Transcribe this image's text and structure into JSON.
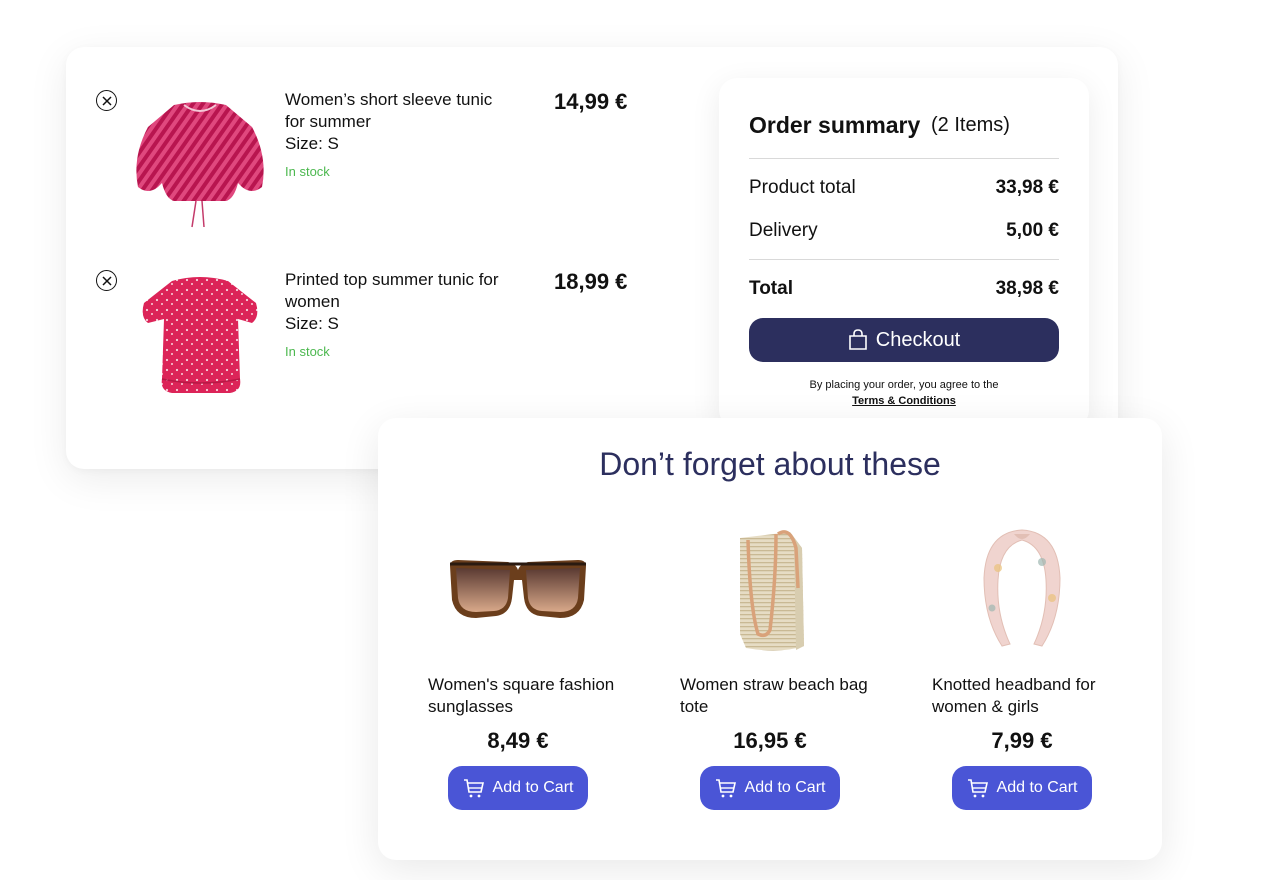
{
  "cart": {
    "items": [
      {
        "name": "Women’s short sleeve tunic for summer",
        "size": "Size: S",
        "stock": "In stock",
        "price": "14,99 €",
        "image": "pink-striped-blouse"
      },
      {
        "name": "Printed top summer tunic for women",
        "size": "Size: S",
        "stock": "In stock",
        "price": "18,99 €",
        "image": "pink-printed-top"
      }
    ]
  },
  "summary": {
    "title": "Order summary",
    "count": "(2 Items)",
    "product_total_label": "Product total",
    "product_total_value": "33,98 €",
    "delivery_label": "Delivery",
    "delivery_value": "5,00 €",
    "total_label": "Total",
    "total_value": "38,98 €",
    "checkout_label": "Checkout",
    "terms_text": "By placing your order, you agree to the",
    "terms_link": "Terms & Conditions"
  },
  "recommendations": {
    "title": "Don’t forget about these",
    "items": [
      {
        "name": "Women's square fashion sunglasses",
        "price": "8,49 €",
        "button": "Add to Cart",
        "image": "sunglasses"
      },
      {
        "name": "Women straw beach bag tote",
        "price": "16,95 €",
        "button": "Add to Cart",
        "image": "straw-bag"
      },
      {
        "name": "Knotted headband for women & girls",
        "price": "7,99 €",
        "button": "Add to Cart",
        "image": "headband"
      }
    ]
  },
  "colors": {
    "primary_dark": "#2c2f5e",
    "accent_button": "#4a55d6",
    "in_stock": "#4cb84f"
  }
}
